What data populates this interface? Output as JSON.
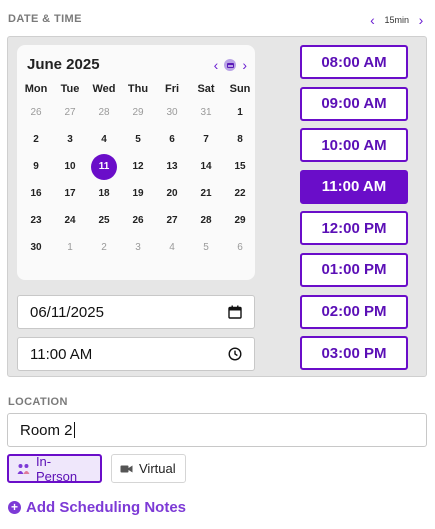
{
  "date_time": {
    "label": "DATE & TIME",
    "interval": {
      "value": "15min",
      "prev_icon": "chevron-left-icon",
      "next_icon": "chevron-right-icon"
    }
  },
  "calendar": {
    "title": "June 2025",
    "weekdays": [
      "Mon",
      "Tue",
      "Wed",
      "Thu",
      "Fri",
      "Sat",
      "Sun"
    ],
    "weeks": [
      [
        {
          "d": "26",
          "other": true
        },
        {
          "d": "27",
          "other": true
        },
        {
          "d": "28",
          "other": true
        },
        {
          "d": "29",
          "other": true
        },
        {
          "d": "30",
          "other": true
        },
        {
          "d": "31",
          "other": true
        },
        {
          "d": "1"
        }
      ],
      [
        {
          "d": "2"
        },
        {
          "d": "3"
        },
        {
          "d": "4"
        },
        {
          "d": "5"
        },
        {
          "d": "6"
        },
        {
          "d": "7"
        },
        {
          "d": "8"
        }
      ],
      [
        {
          "d": "9"
        },
        {
          "d": "10"
        },
        {
          "d": "11",
          "selected": true
        },
        {
          "d": "12"
        },
        {
          "d": "13"
        },
        {
          "d": "14"
        },
        {
          "d": "15"
        }
      ],
      [
        {
          "d": "16"
        },
        {
          "d": "17"
        },
        {
          "d": "18"
        },
        {
          "d": "19"
        },
        {
          "d": "20"
        },
        {
          "d": "21"
        },
        {
          "d": "22"
        }
      ],
      [
        {
          "d": "23"
        },
        {
          "d": "24"
        },
        {
          "d": "25"
        },
        {
          "d": "26"
        },
        {
          "d": "27"
        },
        {
          "d": "28"
        },
        {
          "d": "29"
        }
      ],
      [
        {
          "d": "30"
        },
        {
          "d": "1",
          "other": true
        },
        {
          "d": "2",
          "other": true
        },
        {
          "d": "3",
          "other": true
        },
        {
          "d": "4",
          "other": true
        },
        {
          "d": "5",
          "other": true
        },
        {
          "d": "6",
          "other": true
        }
      ]
    ]
  },
  "date_input": {
    "value": "06/11/2025",
    "icon": "calendar-icon"
  },
  "time_input": {
    "value": "11:00 AM",
    "icon": "clock-icon"
  },
  "time_slots": [
    {
      "label": "08:00 AM"
    },
    {
      "label": "09:00 AM"
    },
    {
      "label": "10:00 AM"
    },
    {
      "label": "11:00 AM",
      "active": true
    },
    {
      "label": "12:00 PM"
    },
    {
      "label": "01:00 PM"
    },
    {
      "label": "02:00 PM"
    },
    {
      "label": "03:00 PM"
    }
  ],
  "location": {
    "label": "LOCATION",
    "value": "Room 2",
    "modes": [
      {
        "label": "In-Person",
        "icon": "people-icon",
        "active": true
      },
      {
        "label": "Virtual",
        "icon": "video-camera-icon"
      }
    ]
  },
  "add_notes": {
    "label": "Add Scheduling Notes",
    "icon": "plus-circle-icon"
  },
  "colors": {
    "accent": "#6a0dc9",
    "panel_bg": "#e6e6e6"
  }
}
